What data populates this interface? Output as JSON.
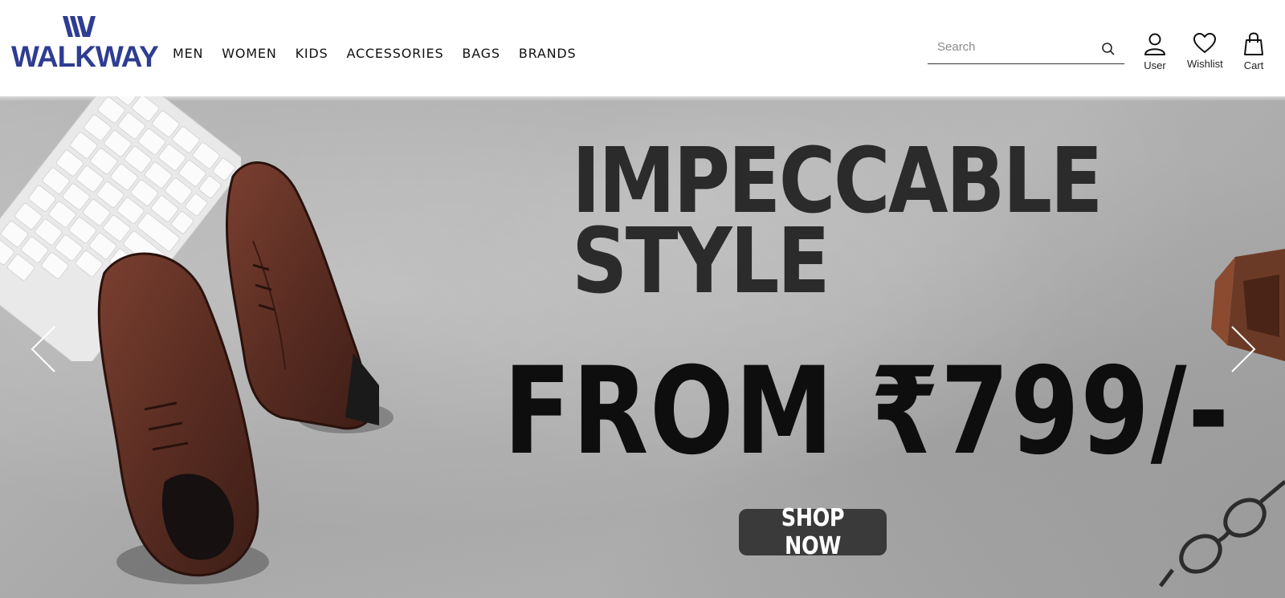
{
  "brand": {
    "name": "WALKWAY",
    "color": "#2e3c92"
  },
  "nav": {
    "items": [
      {
        "label": "MEN"
      },
      {
        "label": "WOMEN"
      },
      {
        "label": "KIDS"
      },
      {
        "label": "ACCESSORIES"
      },
      {
        "label": "BAGS"
      },
      {
        "label": "BRANDS"
      }
    ]
  },
  "search": {
    "placeholder": "Search",
    "value": "",
    "icon": "search-icon"
  },
  "actions": {
    "user": {
      "label": "User",
      "icon": "user-icon"
    },
    "wishlist": {
      "label": "Wishlist",
      "icon": "heart-icon"
    },
    "cart": {
      "label": "Cart",
      "icon": "shopping-bag-icon"
    }
  },
  "hero": {
    "headline_line1": "IMPECCABLE",
    "headline_line2": "STYLE",
    "price_text": "FROM ₹799/-",
    "cta_label": "SHOP NOW",
    "prev_icon": "chevron-left-icon",
    "next_icon": "chevron-right-icon",
    "colors": {
      "headline": "#2b2b2b",
      "price": "#0e0e0e",
      "cta_bg": "#3a3a3a",
      "shoe": "#5a2d22"
    }
  }
}
